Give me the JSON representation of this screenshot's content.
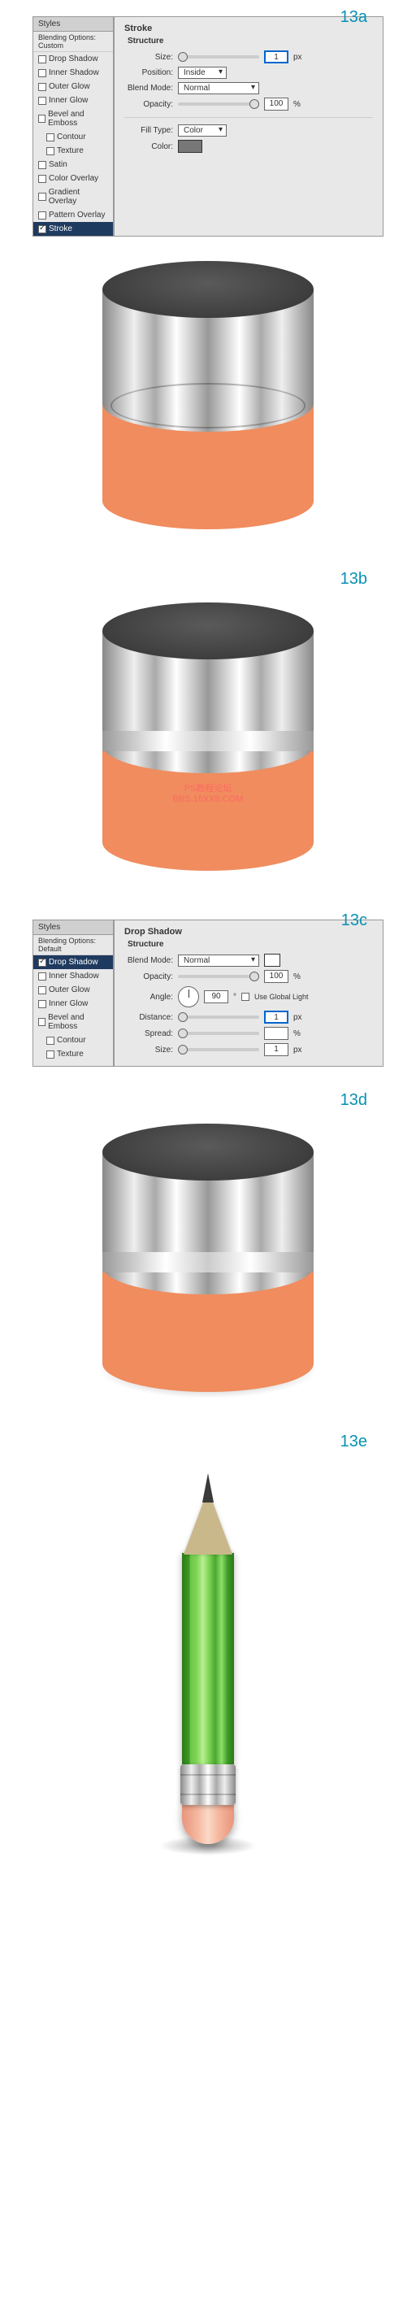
{
  "steps": [
    "13a",
    "13b",
    "13c",
    "13d",
    "13e"
  ],
  "panel13a": {
    "header": "Styles",
    "subheader": "Blending Options: Custom",
    "items": [
      {
        "label": "Drop Shadow",
        "checked": false,
        "indent": false
      },
      {
        "label": "Inner Shadow",
        "checked": false,
        "indent": false
      },
      {
        "label": "Outer Glow",
        "checked": false,
        "indent": false
      },
      {
        "label": "Inner Glow",
        "checked": false,
        "indent": false
      },
      {
        "label": "Bevel and Emboss",
        "checked": false,
        "indent": false
      },
      {
        "label": "Contour",
        "checked": false,
        "indent": true
      },
      {
        "label": "Texture",
        "checked": false,
        "indent": true
      },
      {
        "label": "Satin",
        "checked": false,
        "indent": false
      },
      {
        "label": "Color Overlay",
        "checked": false,
        "indent": false
      },
      {
        "label": "Gradient Overlay",
        "checked": false,
        "indent": false
      },
      {
        "label": "Pattern Overlay",
        "checked": false,
        "indent": false
      }
    ],
    "selected": {
      "label": "Stroke",
      "checked": true
    }
  },
  "stroke": {
    "title": "Stroke",
    "structure": "Structure",
    "size_label": "Size:",
    "size_value": "1",
    "size_unit": "px",
    "position_label": "Position:",
    "position_value": "Inside",
    "blend_label": "Blend Mode:",
    "blend_value": "Normal",
    "opacity_label": "Opacity:",
    "opacity_value": "100",
    "opacity_unit": "%",
    "filltype_label": "Fill Type:",
    "filltype_value": "Color",
    "color_label": "Color:"
  },
  "panel13c": {
    "header": "Styles",
    "subheader": "Blending Options: Default",
    "selected": {
      "label": "Drop Shadow",
      "checked": true
    },
    "items": [
      {
        "label": "Inner Shadow",
        "checked": false,
        "indent": false
      },
      {
        "label": "Outer Glow",
        "checked": false,
        "indent": false
      },
      {
        "label": "Inner Glow",
        "checked": false,
        "indent": false
      },
      {
        "label": "Bevel and Emboss",
        "checked": false,
        "indent": false
      },
      {
        "label": "Contour",
        "checked": false,
        "indent": true
      },
      {
        "label": "Texture",
        "checked": false,
        "indent": true
      }
    ]
  },
  "dropshadow": {
    "title": "Drop Shadow",
    "structure": "Structure",
    "blend_label": "Blend Mode:",
    "blend_value": "Normal",
    "opacity_label": "Opacity:",
    "opacity_value": "100",
    "opacity_unit": "%",
    "angle_label": "Angle:",
    "angle_value": "90",
    "angle_deg": "°",
    "global_label": "Use Global Light",
    "distance_label": "Distance:",
    "distance_value": "1",
    "distance_unit": "px",
    "spread_label": "Spread:",
    "spread_value": "",
    "spread_unit": "%",
    "size_label": "Size:",
    "size_value": "1",
    "size_unit": "px"
  },
  "watermark": {
    "l1": "PS教程论坛",
    "l2": "BBS.16XX8.COM"
  }
}
